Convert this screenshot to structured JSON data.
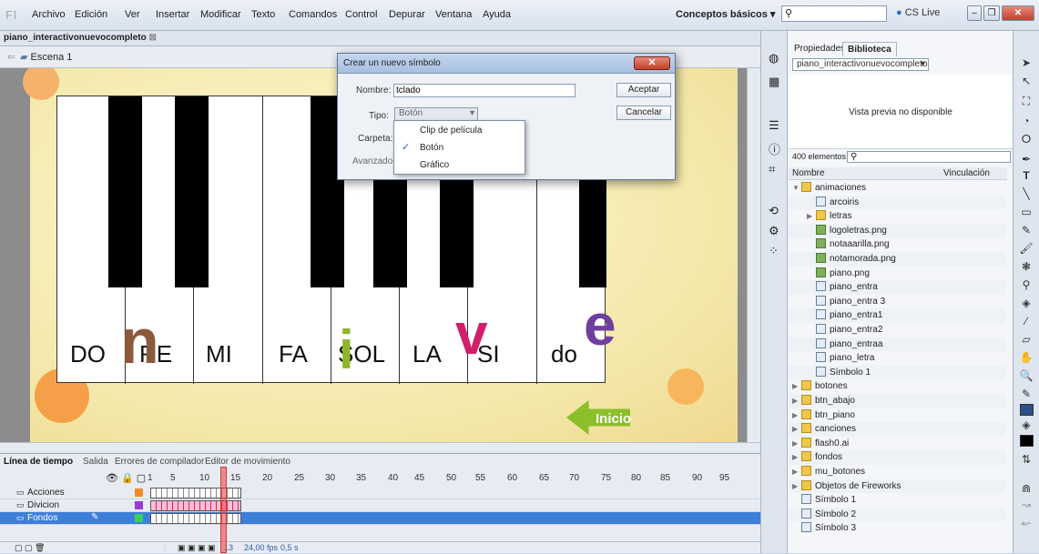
{
  "menu": {
    "logo": "Fl",
    "items": [
      "Archivo",
      "Edición",
      "Ver",
      "Insertar",
      "Modificar",
      "Texto",
      "Comandos",
      "Control",
      "Depurar",
      "Ventana",
      "Ayuda"
    ],
    "workspace": "Conceptos básicos",
    "cslive": "CS Live"
  },
  "document": {
    "tab": "piano_interactivonuevocompleto",
    "scene": "Escena 1"
  },
  "stage": {
    "keys": [
      "DO",
      "RE",
      "MI",
      "FA",
      "SOL",
      "LA",
      "SI",
      "do"
    ],
    "home": "Inicio",
    "deco_letters": [
      "n",
      "i",
      "v",
      "e"
    ]
  },
  "dialog": {
    "title": "Crear un nuevo símbolo",
    "name_label": "Nombre:",
    "name_value": "tclado",
    "type_label": "Tipo:",
    "type_value": "Botón",
    "folder_label": "Carpeta:",
    "advanced_label": "Avanzado",
    "ok": "Aceptar",
    "cancel": "Cancelar",
    "options": [
      "Clip de película",
      "Botón",
      "Gráfico"
    ]
  },
  "timeline": {
    "tabs": [
      "Línea de tiempo",
      "Salida",
      "Errores de compilador",
      "Editor de movimiento"
    ],
    "frame_numbers": [
      "1",
      "5",
      "10",
      "15",
      "20",
      "25",
      "30",
      "35",
      "40",
      "45",
      "50",
      "55",
      "60",
      "65",
      "70",
      "75",
      "80",
      "85",
      "90",
      "95"
    ],
    "layers": [
      "Acciones",
      "Divicion",
      "Fondos"
    ],
    "current_frame": "13",
    "fps": "24,00 fps",
    "time": "0,5 s"
  },
  "panel": {
    "tabs": [
      "Propiedades",
      "Biblioteca"
    ],
    "library_select": "piano_interactivonuevocompleto",
    "preview": "Vista previa no disponible",
    "count": "400 elementos",
    "col_name": "Nombre",
    "col_link": "Vinculación",
    "items": [
      {
        "n": "animaciones",
        "t": "folder",
        "lvl": 0
      },
      {
        "n": "arcoiris",
        "t": "sym",
        "lvl": 1
      },
      {
        "n": "letras",
        "t": "folder",
        "lvl": 1
      },
      {
        "n": "logoletras.png",
        "t": "img",
        "lvl": 1
      },
      {
        "n": "notaaarilla.png",
        "t": "img",
        "lvl": 1
      },
      {
        "n": "notamorada.png",
        "t": "img",
        "lvl": 1
      },
      {
        "n": "piano.png",
        "t": "img",
        "lvl": 1
      },
      {
        "n": "piano_entra",
        "t": "sym",
        "lvl": 1
      },
      {
        "n": "piano_entra 3",
        "t": "sym",
        "lvl": 1
      },
      {
        "n": "piano_entra1",
        "t": "sym",
        "lvl": 1
      },
      {
        "n": "piano_entra2",
        "t": "sym",
        "lvl": 1
      },
      {
        "n": "piano_entraa",
        "t": "sym",
        "lvl": 1
      },
      {
        "n": "piano_letra",
        "t": "sym",
        "lvl": 1
      },
      {
        "n": "Símbolo 1",
        "t": "sym",
        "lvl": 1
      },
      {
        "n": "botones",
        "t": "folder",
        "lvl": 0
      },
      {
        "n": "btn_abajo",
        "t": "folder",
        "lvl": 0
      },
      {
        "n": "btn_piano",
        "t": "folder",
        "lvl": 0
      },
      {
        "n": "canciones",
        "t": "folder",
        "lvl": 0
      },
      {
        "n": "flash0.ai",
        "t": "folder",
        "lvl": 0
      },
      {
        "n": "fondos",
        "t": "folder",
        "lvl": 0
      },
      {
        "n": "mu_botones",
        "t": "folder",
        "lvl": 0
      },
      {
        "n": "Objetos de Fireworks",
        "t": "folder",
        "lvl": 0
      },
      {
        "n": "Símbolo 1",
        "t": "sym",
        "lvl": 0
      },
      {
        "n": "Símbolo 2",
        "t": "sym",
        "lvl": 0
      },
      {
        "n": "Símbolo 3",
        "t": "sym",
        "lvl": 0
      }
    ]
  }
}
